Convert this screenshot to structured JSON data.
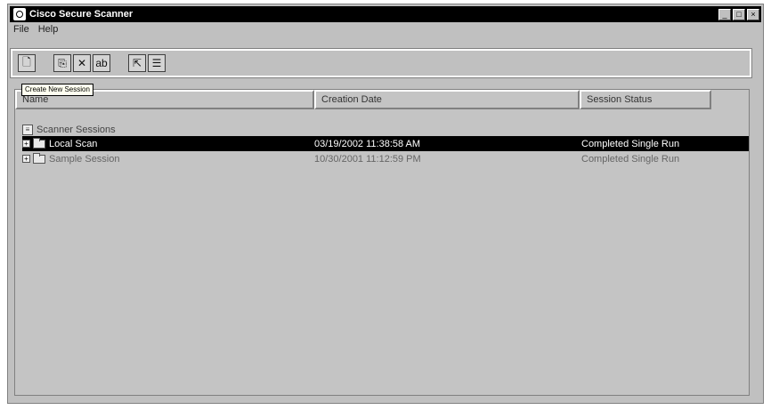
{
  "window": {
    "title": "Cisco Secure Scanner",
    "minimize_glyph": "_",
    "maximize_glyph": "□",
    "close_glyph": "×"
  },
  "menu": {
    "items": [
      "File",
      "Help"
    ]
  },
  "toolbar": {
    "buttons": [
      {
        "icon": "new-session-icon",
        "glyph": "🗋"
      },
      {
        "icon": "open-session-icon",
        "glyph": "⎘"
      },
      {
        "icon": "delete-icon",
        "glyph": "✕"
      },
      {
        "icon": "rename-icon",
        "glyph": "ab"
      },
      {
        "icon": "export-icon",
        "glyph": "⇱"
      },
      {
        "icon": "properties-icon",
        "glyph": "☰"
      }
    ]
  },
  "tooltip": {
    "text": "Create New Session"
  },
  "list": {
    "columns": [
      "Name",
      "Creation Date",
      "Session Status"
    ],
    "root": {
      "label": "Scanner Sessions"
    },
    "rows": [
      {
        "name": "Local Scan",
        "date": "03/19/2002 11:38:58 AM",
        "status": "Completed Single Run",
        "selected": true
      },
      {
        "name": "Sample Session",
        "date": "10/30/2001 11:12:59 PM",
        "status": "Completed Single Run",
        "selected": false
      }
    ]
  },
  "colors": {
    "window_bg": "#c0c0c0",
    "titlebar_bg": "#000000",
    "selection_bg": "#000000",
    "selection_fg": "#ffffff"
  }
}
